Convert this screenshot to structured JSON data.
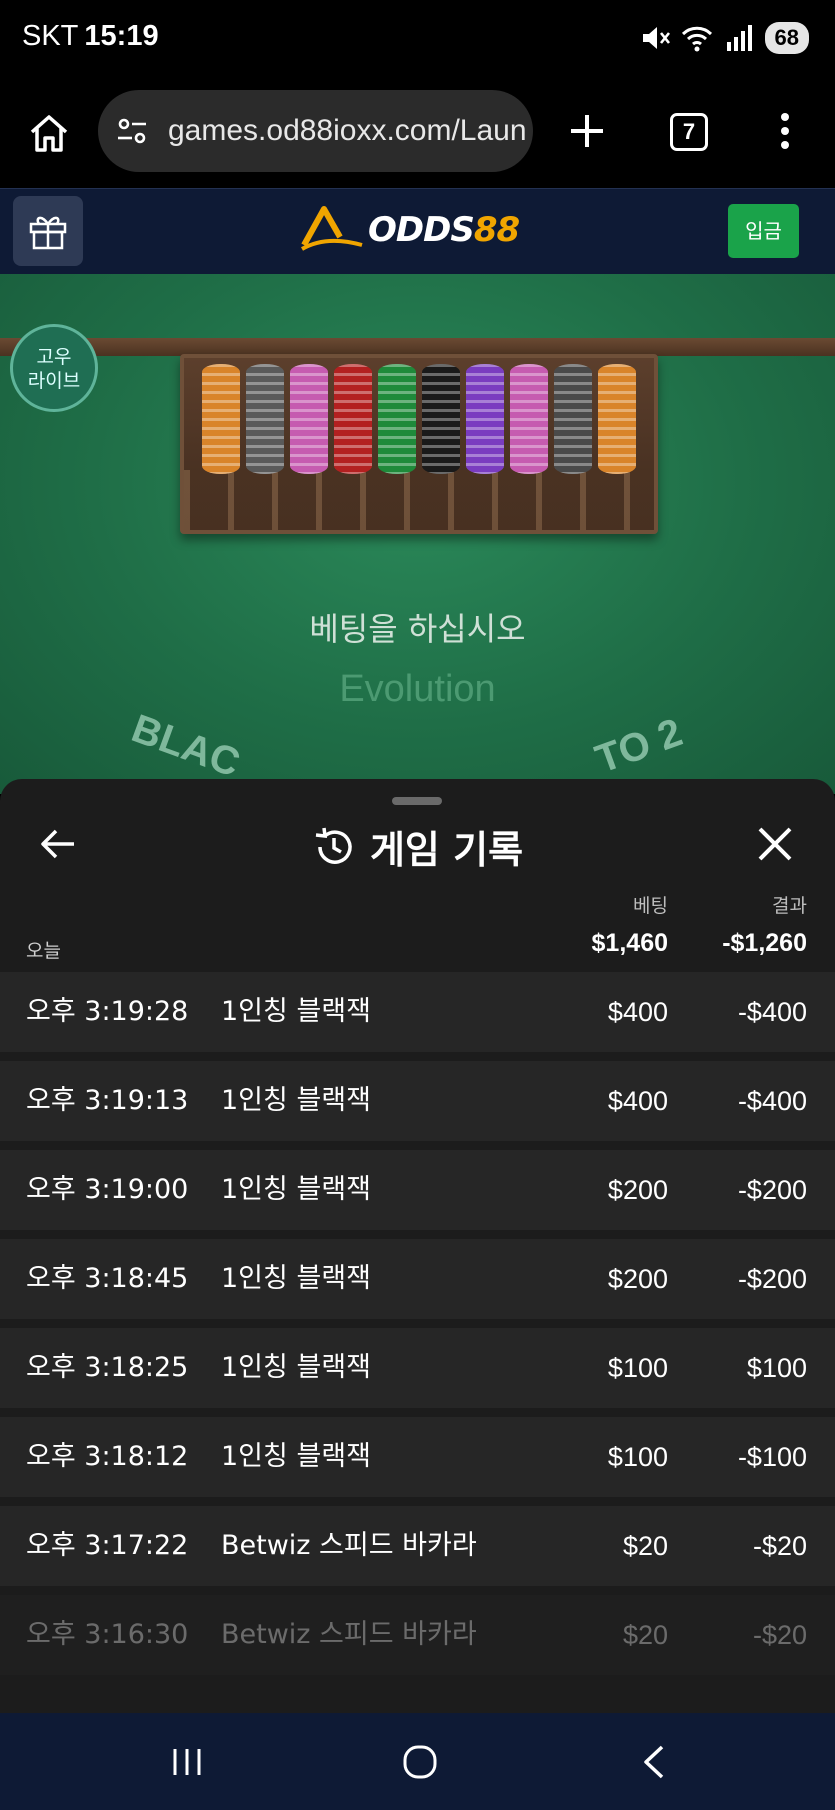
{
  "status_bar": {
    "carrier": "SKT",
    "time": "15:19",
    "battery": "68",
    "icons": [
      "mute-icon",
      "wifi-icon",
      "signal-icon"
    ]
  },
  "browser": {
    "url": "games.od88ioxx.com/Laun",
    "tab_count": "7",
    "icons": [
      "home-icon",
      "site-settings-icon",
      "new-tab-icon",
      "menu-icon"
    ]
  },
  "site_header": {
    "logo_text_white": "ODDS",
    "logo_text_gold": "88",
    "deposit_label": "입금",
    "colors": {
      "header_bg": "#0e1a35",
      "deposit_bg": "#1aa34a",
      "logo_gold": "#f0a500"
    }
  },
  "game": {
    "live_badge_line1": "고우",
    "live_badge_line2": "라이브",
    "prompt": "베팅을 하십시오",
    "provider": "Evolution",
    "table_text_left": "BLAC",
    "table_text_right": "TO 2"
  },
  "history": {
    "title": "게임 기록",
    "col_bet": "베팅",
    "col_result": "결과",
    "today_label": "오늘",
    "total_bet": "$1,460",
    "total_result": "-$1,260",
    "rows": [
      {
        "time": "오후 3:19:28",
        "game": "1인칭 블랙잭",
        "bet": "$400",
        "result": "-$400"
      },
      {
        "time": "오후 3:19:13",
        "game": "1인칭 블랙잭",
        "bet": "$400",
        "result": "-$400"
      },
      {
        "time": "오후 3:19:00",
        "game": "1인칭 블랙잭",
        "bet": "$200",
        "result": "-$200"
      },
      {
        "time": "오후 3:18:45",
        "game": "1인칭 블랙잭",
        "bet": "$200",
        "result": "-$200"
      },
      {
        "time": "오후 3:18:25",
        "game": "1인칭 블랙잭",
        "bet": "$100",
        "result": "$100"
      },
      {
        "time": "오후 3:18:12",
        "game": "1인칭 블랙잭",
        "bet": "$100",
        "result": "-$100"
      },
      {
        "time": "오후 3:17:22",
        "game": "Betwiz 스피드 바카라",
        "bet": "$20",
        "result": "-$20"
      },
      {
        "time": "오후 3:16:30",
        "game": "Betwiz 스피드 바카라",
        "bet": "$20",
        "result": "-$20"
      }
    ]
  },
  "nav_bar": {
    "icons": [
      "recent-apps-icon",
      "home-icon",
      "back-icon"
    ]
  }
}
